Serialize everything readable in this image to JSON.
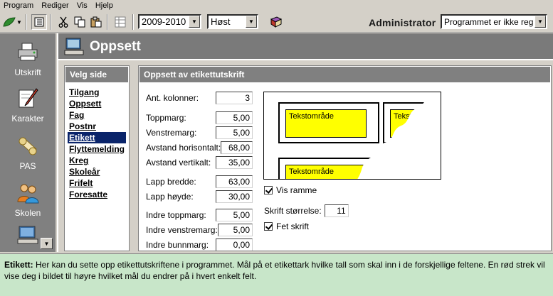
{
  "menu": [
    "Program",
    "Rediger",
    "Vis",
    "Hjelp"
  ],
  "toolbar": {
    "year_select": "2009-2010",
    "term_select": "Høst",
    "admin_label": "Administrator",
    "program_select": "Programmet er ikke reg"
  },
  "rail": {
    "items": [
      {
        "label": "Utskrift",
        "icon": "printer-icon"
      },
      {
        "label": "Karakter",
        "icon": "pen-icon"
      },
      {
        "label": "PAS",
        "icon": "diploma-icon"
      },
      {
        "label": "Skolen",
        "icon": "people-icon"
      }
    ]
  },
  "header": {
    "title": "Oppsett"
  },
  "velg_side": {
    "title": "Velg side",
    "items": [
      "Tilgang",
      "Oppsett",
      "Fag",
      "Postnr",
      "Etikett",
      "Flyttemelding",
      "Kreg",
      "Skoleår",
      "Frifelt",
      "Foresatte"
    ],
    "active": "Etikett"
  },
  "etikett": {
    "title": "Oppsett av etikettutskrift",
    "fields": [
      {
        "label": "Ant. kolonner:",
        "value": "3"
      },
      {
        "label": "Toppmarg:",
        "value": "5,00"
      },
      {
        "label": "Venstremarg:",
        "value": "5,00"
      },
      {
        "label": "Avstand horisontalt:",
        "value": "68,00"
      },
      {
        "label": "Avstand vertikalt:",
        "value": "35,00"
      },
      {
        "label": "Lapp bredde:",
        "value": "63,00"
      },
      {
        "label": "Lapp høyde:",
        "value": "30,00"
      },
      {
        "label": "Indre toppmarg:",
        "value": "5,00"
      },
      {
        "label": "Indre venstremarg:",
        "value": "5,00"
      },
      {
        "label": "Indre bunnmarg:",
        "value": "0,00"
      }
    ],
    "preview_text": "Tekstområde",
    "vis_ramme_label": "Vis ramme",
    "vis_ramme_checked": true,
    "skrift_label": "Skrift størrelse:",
    "skrift_value": "11",
    "fet_skrift_label": "Fet skrift",
    "fet_skrift_checked": true
  },
  "footer": {
    "title": "Etikett:",
    "text": "Her kan du sette opp etikettutskriftene i programmet. Mål på et etikettark hvilke tall som skal inn i de forskjellige feltene. En rød strek vil vise deg i bildet til høyre hvilket mål du endrer på i hvert enkelt felt."
  },
  "colors": {
    "accent": "#0a246a",
    "label_fill": "#ffff00",
    "footer_bg": "#c8e6c9",
    "header_bg": "#7a7a7a"
  }
}
